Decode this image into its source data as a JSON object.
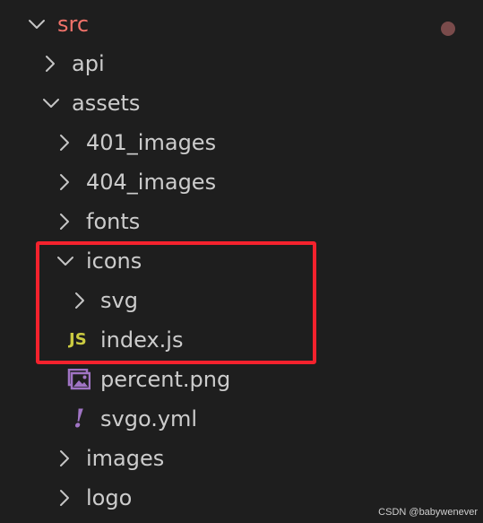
{
  "explorer": {
    "modified_dot_color": "#7a4b4b",
    "items": [
      {
        "label": "src",
        "kind": "folder",
        "expanded": true,
        "color": "#f0726a"
      },
      {
        "label": "api",
        "kind": "folder",
        "expanded": false
      },
      {
        "label": "assets",
        "kind": "folder",
        "expanded": true
      },
      {
        "label": "401_images",
        "kind": "folder",
        "expanded": false
      },
      {
        "label": "404_images",
        "kind": "folder",
        "expanded": false
      },
      {
        "label": "fonts",
        "kind": "folder",
        "expanded": false
      },
      {
        "label": "icons",
        "kind": "folder",
        "expanded": true
      },
      {
        "label": "svg",
        "kind": "folder",
        "expanded": false
      },
      {
        "label": "index.js",
        "kind": "file",
        "icon": "js-file-icon",
        "badge": "JS"
      },
      {
        "label": "percent.png",
        "kind": "file",
        "icon": "image-file-icon"
      },
      {
        "label": "svgo.yml",
        "kind": "file",
        "icon": "yaml-file-icon",
        "badge": "!"
      },
      {
        "label": "images",
        "kind": "folder",
        "expanded": false
      },
      {
        "label": "logo",
        "kind": "folder",
        "expanded": false
      }
    ]
  },
  "annotation": {
    "color": "#f5222d"
  },
  "watermark": "CSDN @babywenever",
  "colors": {
    "background": "#1e1e1e",
    "text": "#cccccc",
    "chevron": "#c5c5c5",
    "js": "#cbcb41",
    "yaml": "#a074c4",
    "image": "#a074c4"
  }
}
